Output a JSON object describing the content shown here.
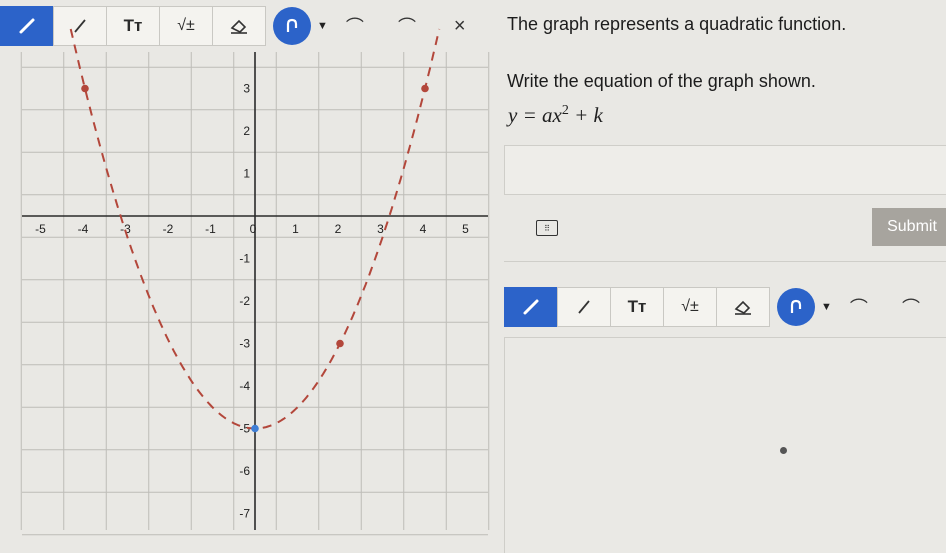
{
  "toolbar_top": {
    "tools": [
      {
        "name": "pen-tool",
        "icon": "pencil-icon"
      },
      {
        "name": "line-tool",
        "icon": "line-icon"
      },
      {
        "name": "text-tool",
        "label": "Tт"
      },
      {
        "name": "math-tool",
        "label": "√±"
      },
      {
        "name": "eraser-tool",
        "icon": "eraser-icon"
      }
    ],
    "undo_icon": "undo-icon",
    "close_label": "×"
  },
  "question": {
    "line1": "The graph represents a quadratic function.",
    "line2": "Write the equation of the graph shown.",
    "formula": "y = ax",
    "formula_exp": "2",
    "formula_tail": " + k"
  },
  "answer": {
    "value": "",
    "keyboard_icon": "keyboard-icon"
  },
  "submit_label": "Submit",
  "toolbar_bottom": {
    "text_label": "Tт",
    "math_label": "√±"
  },
  "chart_data": {
    "type": "line",
    "x_ticks": [
      "-5",
      "-4",
      "-3",
      "-2",
      "-1",
      "0",
      "1",
      "2",
      "3",
      "4",
      "5"
    ],
    "y_ticks": [
      "3",
      "2",
      "1",
      "-1",
      "-2",
      "-3",
      "-4",
      "-5",
      "-6",
      "-7"
    ],
    "xlim": [
      -5.5,
      5.5
    ],
    "ylim": [
      -7.5,
      4.0
    ],
    "grid": true,
    "curve": {
      "a": 0.5,
      "k": -5,
      "style": "dashed",
      "color": "#b3473b"
    },
    "points": [
      {
        "x": -4,
        "y": 3,
        "color": "#b3473b"
      },
      {
        "x": 2,
        "y": -3,
        "color": "#b3473b"
      },
      {
        "x": 4,
        "y": 3,
        "color": "#b3473b"
      },
      {
        "x": 0,
        "y": -5,
        "color": "#3f7fd6"
      }
    ]
  }
}
